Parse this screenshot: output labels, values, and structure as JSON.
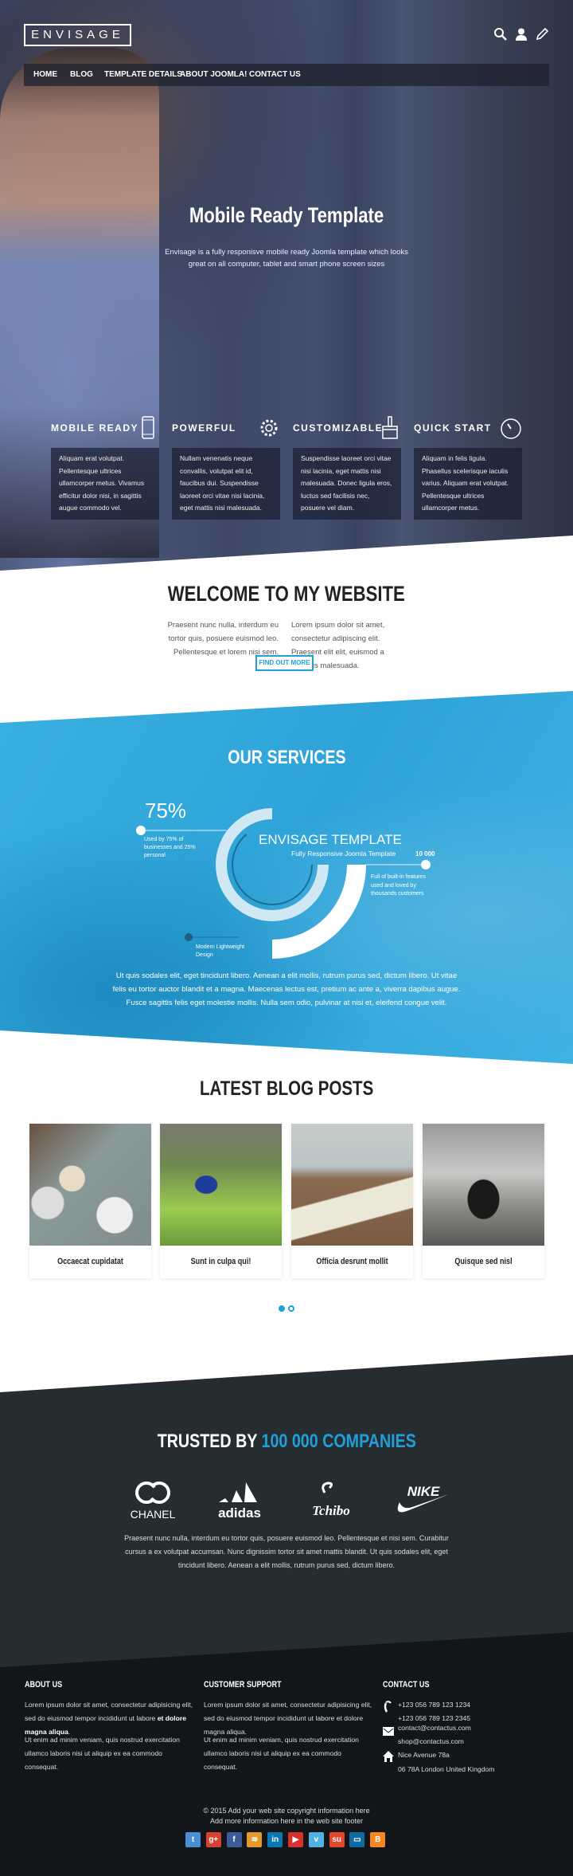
{
  "header": {
    "logo": "ENVISAGE",
    "icons": [
      "search-icon",
      "user-icon",
      "pencil-icon"
    ],
    "nav": [
      {
        "label": "HOME"
      },
      {
        "label": "BLOG"
      },
      {
        "label": "TEMPLATE DETAILS"
      },
      {
        "label": "ABOUT JOOMLA!"
      },
      {
        "label": "CONTACT US"
      }
    ]
  },
  "hero": {
    "title": "Mobile Ready Template",
    "subtitle": "Envisage is a fully responisve mobile ready Joomla template which looks great on all computer, tablet and smart phone screen sizes"
  },
  "features": [
    {
      "title": "MOBILE READY",
      "icon": "smartphone-icon",
      "text": "Aliquam erat volutpat. Pellentesque ultrices ullamcorper metus. Vivamus efficitur dolor nisi, in sagittis augue commodo vel."
    },
    {
      "title": "POWERFUL",
      "icon": "gear-icon",
      "text": "Nullam venenatis neque convallis, volutpat elit id, faucibus dui. Suspendisse laoreet orci vitae nisi lacinia, eget mattis nisi malesuada."
    },
    {
      "title": "CUSTOMIZABLE",
      "icon": "paint-brush-icon",
      "text": "Suspendisse laoreet orci vitae nisi lacinia, eget mattis nisi malesuada. Donec ligula eros, luctus sed facilisis nec, posuere vel diam."
    },
    {
      "title": "QUICK START",
      "icon": "stopwatch-icon",
      "text": "Aliquam in felis ligula. Phasellus scelerisque iaculis varius. Aliquam erat volutpat. Pellentesque ultrices ullamcorper metus."
    }
  ],
  "welcome": {
    "title": "WELCOME TO MY WEBSITE",
    "left": "Praesent nunc nulla, interdum eu tortor quis, posuere euismod leo. Pellentesque et lorem nisi sem.",
    "right": "Lorem ipsum dolor sit amet, consectetur adipiscing elit. Praesent elit elit, euismod a rhoncus malesuada.",
    "button": "FIND OUT MORE"
  },
  "services": {
    "title": "OUR SERVICES",
    "percent": "75%",
    "percent_text": "Used by 75% of businesses and 25% personal",
    "center_title": "ENVISAGE TEMPLATE",
    "center_sub": "Fully Responsive Joomla Template",
    "count": "10 000",
    "count_text": "Full of built-in features used and loved by thousands customers",
    "design_text": "Modern Lightweight Design",
    "ring_fraction": 0.75,
    "paragraph": "Ut quis sodales elit, eget tincidunt libero. Aenean a elit mollis, rutrum purus sed, dictum libero. Ut vitae felis eu tortor auctor blandit et a magna. Maecenas lectus est, pretium ac ante a, viverra dapibus augue. Fusce sagittis felis eget molestie mollis. Nulla sem odio, pulvinar at nisi et, eleifend congue velit."
  },
  "blog": {
    "title": "LATEST BLOG POSTS",
    "posts": [
      {
        "title": "Occaecat cupidatat"
      },
      {
        "title": "Sunt in culpa qui!"
      },
      {
        "title": "Officia desrunt mollit"
      },
      {
        "title": "Quisque sed nisl"
      }
    ],
    "pages": 2,
    "active_page": 1
  },
  "trusted": {
    "title_a": "TRUSTED BY ",
    "title_b": "100 000 COMPANIES",
    "accent": "#1fa0dc",
    "brands": [
      "CHANEL",
      "adidas",
      "Tchibo",
      "NIKE"
    ],
    "paragraph": "Praesent nunc nulla, interdum eu tortor quis, posuere euismod leo. Pellentesque et nisi sem. Curabitur cursus a ex volutpat accumsan. Nunc dignissim tortor sit amet mattis blandit. Ut quis sodales elit, eget tincidunt libero. Aenean a elit mollis, rutrum purus sed, dictum libero."
  },
  "footer": {
    "about": {
      "title": "ABOUT US",
      "p1": "Lorem ipsum dolor sit amet, consectetur adipisicing elit, sed do eiusmod tempor incididunt ut labore ",
      "p1_bold": "et dolore magna aliqua",
      "p2": "Ut enim ad minim veniam, quis nostrud exercitation ullamco laboris nisi ut aliquip ex ea commodo consequat."
    },
    "support": {
      "title": "CUSTOMER SUPPORT",
      "p1": "Lorem ipsum dolor sit amet, consectetur adipisicing elit, sed do eiusmod tempor incididunt ut labore et dolore magna aliqua.",
      "p2": "Ut enim ad minim veniam, quis nostrud exercitation ullamco laboris nisi ut aliquip ex ea commodo consequat."
    },
    "contact": {
      "title": "CONTACT US",
      "phone1": "+123 056 789 123 1234",
      "phone2": "+123 056 789 123 2345",
      "email1": "contact@contactus.com",
      "email2": "shop@contactus.com",
      "addr1": "Nice Avenue 78a",
      "addr2": "06 78A London United Kingdom"
    },
    "copyright": "© 2015 Add your web site copyright information here",
    "more": "Add more information here in the web site footer",
    "social": [
      {
        "name": "twitter",
        "color": "#4a8fd4",
        "glyph": "t"
      },
      {
        "name": "google-plus",
        "color": "#d9412f",
        "glyph": "g+"
      },
      {
        "name": "facebook",
        "color": "#3b5b9a",
        "glyph": "f"
      },
      {
        "name": "rss",
        "color": "#e49a2a",
        "glyph": "≋"
      },
      {
        "name": "linkedin",
        "color": "#0a79b3",
        "glyph": "in"
      },
      {
        "name": "youtube",
        "color": "#d8302a",
        "glyph": "▶"
      },
      {
        "name": "vimeo",
        "color": "#4fb2e0",
        "glyph": "v"
      },
      {
        "name": "stumbleupon",
        "color": "#e5472b",
        "glyph": "su"
      },
      {
        "name": "delicious",
        "color": "#0e6aa0",
        "glyph": "▭"
      },
      {
        "name": "blogger",
        "color": "#f5871f",
        "glyph": "B"
      }
    ]
  }
}
